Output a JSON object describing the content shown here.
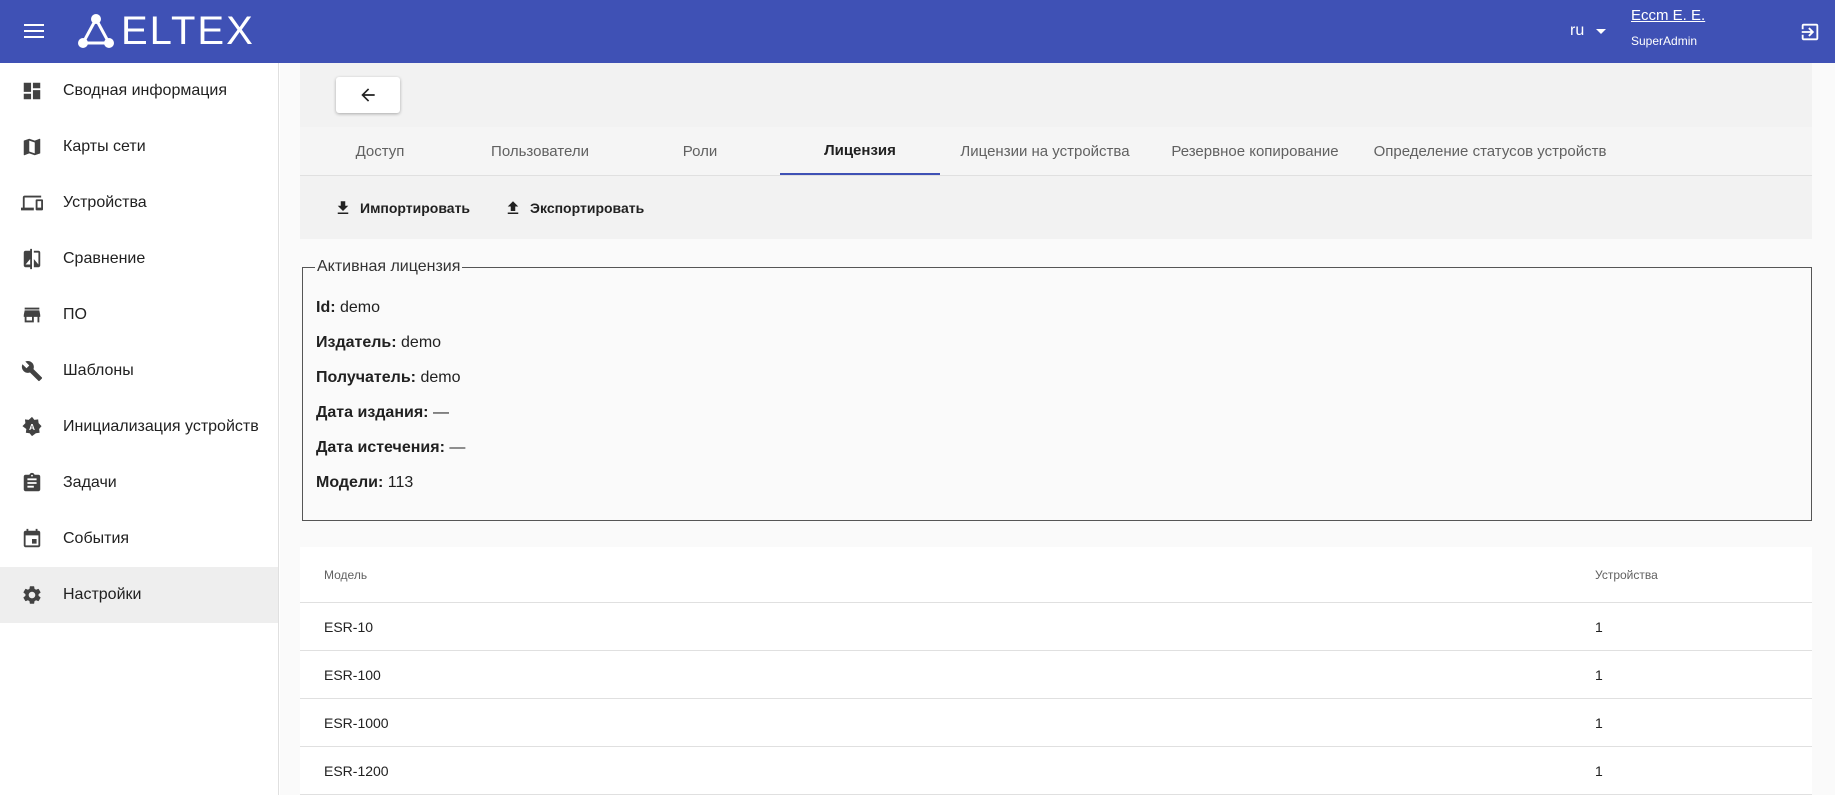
{
  "header": {
    "logo_text": "ELTEX",
    "language": "ru",
    "user_name": "Eccm E. E.",
    "user_role": "SuperAdmin"
  },
  "sidebar": {
    "items": [
      {
        "label": "Сводная информация",
        "icon": "dashboard-icon"
      },
      {
        "label": "Карты сети",
        "icon": "map-icon"
      },
      {
        "label": "Устройства",
        "icon": "devices-icon"
      },
      {
        "label": "Сравнение",
        "icon": "compare-icon"
      },
      {
        "label": "ПО",
        "icon": "store-icon"
      },
      {
        "label": "Шаблоны",
        "icon": "wrench-icon"
      },
      {
        "label": "Инициализация устройств",
        "icon": "auto-setup-icon"
      },
      {
        "label": "Задачи",
        "icon": "clipboard-icon"
      },
      {
        "label": "События",
        "icon": "calendar-icon"
      },
      {
        "label": "Настройки",
        "icon": "gear-icon",
        "active": true
      }
    ]
  },
  "tabs": [
    {
      "label": "Доступ"
    },
    {
      "label": "Пользователи"
    },
    {
      "label": "Роли"
    },
    {
      "label": "Лицензия",
      "active": true
    },
    {
      "label": "Лицензии на устройства"
    },
    {
      "label": "Резервное копирование"
    },
    {
      "label": "Определение статусов устройств"
    }
  ],
  "toolbar": {
    "import_label": "Импортировать",
    "export_label": "Экспортировать"
  },
  "license": {
    "legend": "Активная лицензия",
    "fields": [
      {
        "key": "Id:",
        "value": "demo"
      },
      {
        "key": "Издатель:",
        "value": "demo"
      },
      {
        "key": "Получатель:",
        "value": "demo"
      },
      {
        "key": "Дата издания:",
        "value": "—"
      },
      {
        "key": "Дата истечения:",
        "value": "—"
      },
      {
        "key": "Модели:",
        "value": "113"
      }
    ]
  },
  "table": {
    "headers": [
      "Модель",
      "Устройства"
    ],
    "rows": [
      [
        "ESR-10",
        "1"
      ],
      [
        "ESR-100",
        "1"
      ],
      [
        "ESR-1000",
        "1"
      ],
      [
        "ESR-1200",
        "1"
      ]
    ]
  },
  "colors": {
    "primary": "#3f51b5",
    "active_bg": "#eeeeee"
  }
}
